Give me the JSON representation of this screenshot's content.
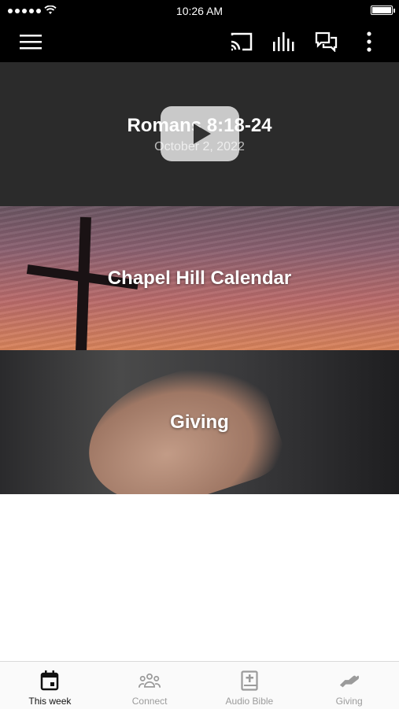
{
  "status_bar": {
    "time": "10:26 AM"
  },
  "app_bar": {
    "icons": [
      "menu-icon",
      "cast-icon",
      "audio-bars-icon",
      "chat-icon",
      "more-vertical-icon"
    ]
  },
  "tiles": {
    "sermon": {
      "title": "Romans 8:18-24",
      "date": "October 2, 2022"
    },
    "calendar": {
      "title": "Chapel Hill Calendar"
    },
    "giving": {
      "title": "Giving"
    }
  },
  "tab_bar": {
    "tabs": [
      {
        "label": "This week",
        "icon": "calendar-icon",
        "active": true
      },
      {
        "label": "Connect",
        "icon": "people-icon",
        "active": false
      },
      {
        "label": "Audio Bible",
        "icon": "bible-icon",
        "active": false
      },
      {
        "label": "Giving",
        "icon": "giving-hand-icon",
        "active": false
      }
    ]
  },
  "colors": {
    "active_tab": "#111111",
    "inactive_tab": "#9b9b9b"
  }
}
